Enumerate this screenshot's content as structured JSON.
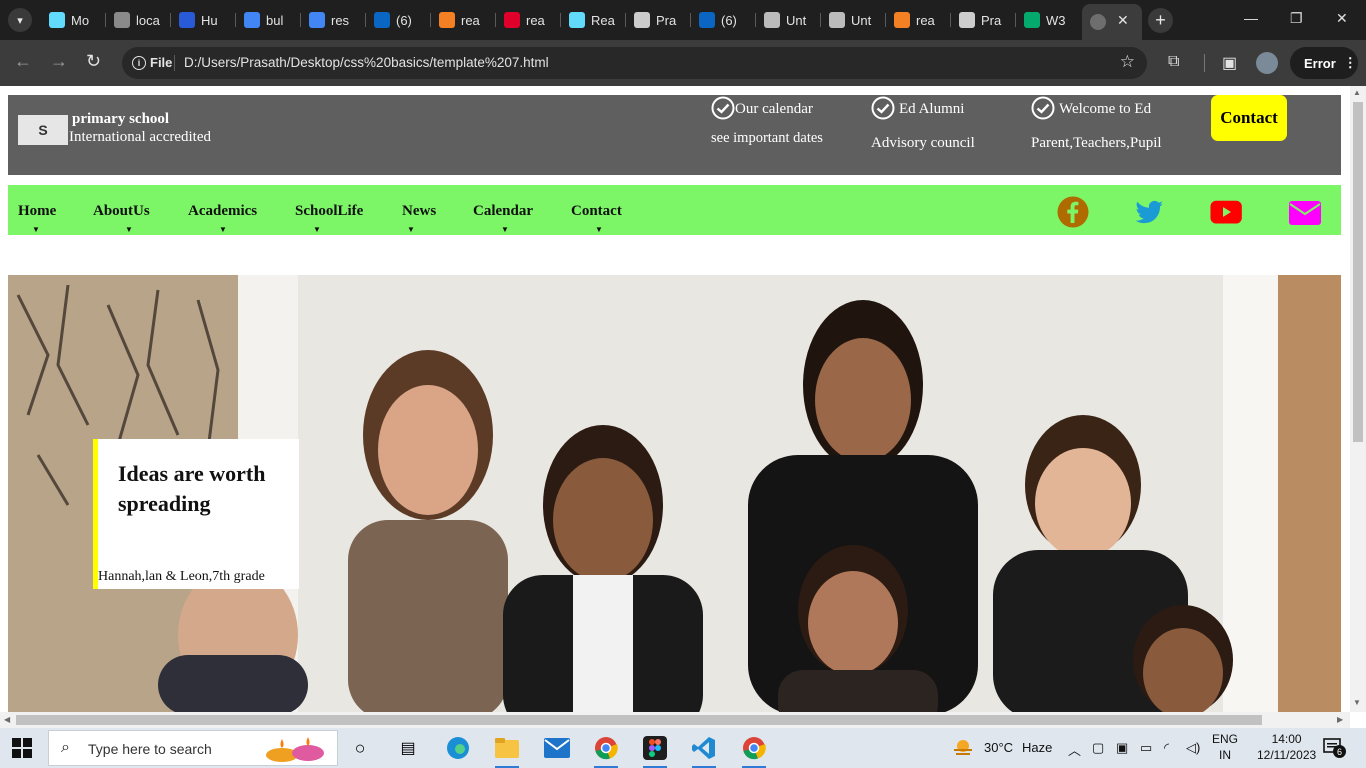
{
  "browser": {
    "tabs": [
      {
        "label": "Mo",
        "icon": "react-icon",
        "color": "#61dafb"
      },
      {
        "label": "loca",
        "icon": "local-icon",
        "color": "#8a8a8a"
      },
      {
        "label": "Hu",
        "icon": "h-icon",
        "color": "#2a5bd7"
      },
      {
        "label": "bul",
        "icon": "google-icon",
        "color": "#4285f4"
      },
      {
        "label": "res",
        "icon": "google-icon",
        "color": "#4285f4"
      },
      {
        "label": "(6)",
        "icon": "linkedin-icon",
        "color": "#0a66c2"
      },
      {
        "label": "rea",
        "icon": "stack-icon",
        "color": "#f48024"
      },
      {
        "label": "rea",
        "icon": "n-icon",
        "color": "#e0002a"
      },
      {
        "label": "Rea",
        "icon": "react-icon",
        "color": "#61dafb"
      },
      {
        "label": "Pra",
        "icon": "github-icon",
        "color": "#cccccc"
      },
      {
        "label": "(6)",
        "icon": "linkedin-icon",
        "color": "#0a66c2"
      },
      {
        "label": "Unt",
        "icon": "globe-icon",
        "color": "#bbbbbb"
      },
      {
        "label": "Unt",
        "icon": "globe-icon",
        "color": "#bbbbbb"
      },
      {
        "label": "rea",
        "icon": "stack-icon",
        "color": "#f48024"
      },
      {
        "label": "Pra",
        "icon": "github-icon",
        "color": "#cccccc"
      },
      {
        "label": "W3",
        "icon": "w3-icon",
        "color": "#04aa6d"
      }
    ],
    "url_scheme_label": "File",
    "url": "D:/Users/Prasath/Desktop/css%20basics/template%207.html",
    "profile_status": "Error"
  },
  "site": {
    "logo_text": "S",
    "school_name": "primary school",
    "school_subtitle": "International accredited",
    "info": [
      {
        "title": "Our calendar",
        "subtitle": "see important dates"
      },
      {
        "title": "Ed Alumni",
        "subtitle": "Advisory council"
      },
      {
        "title": "Welcome to Ed",
        "subtitle": "Parent,Teachers,Pupil"
      }
    ],
    "contact_button": "Contact",
    "nav": [
      "Home",
      "AboutUs",
      "Academics",
      "SchoolLife",
      "News",
      "Calendar",
      "Contact"
    ],
    "caret": "▼",
    "social": [
      {
        "name": "facebook-icon",
        "color": "#b06b00"
      },
      {
        "name": "twitter-icon",
        "color": "#1a9bd6"
      },
      {
        "name": "youtube-icon",
        "color": "#ff0000"
      },
      {
        "name": "mail-icon",
        "color": "#ff00ff"
      }
    ],
    "hero": {
      "quote_title": "Ideas are worth spreading",
      "quote_credit": "Hannah,lan & Leon,7th grade"
    },
    "colors": {
      "header_bg": "#5f5f5f",
      "nav_bg": "#7cf566",
      "contact_bg": "#ffff00",
      "quote_border": "#ffff00"
    }
  },
  "taskbar": {
    "search_placeholder": "Type here to search",
    "weather_temp": "30°C",
    "weather_text": "Haze",
    "language_line1": "ENG",
    "language_line2": "IN",
    "time": "14:00",
    "date": "12/11/2023",
    "notification_count": "6"
  }
}
